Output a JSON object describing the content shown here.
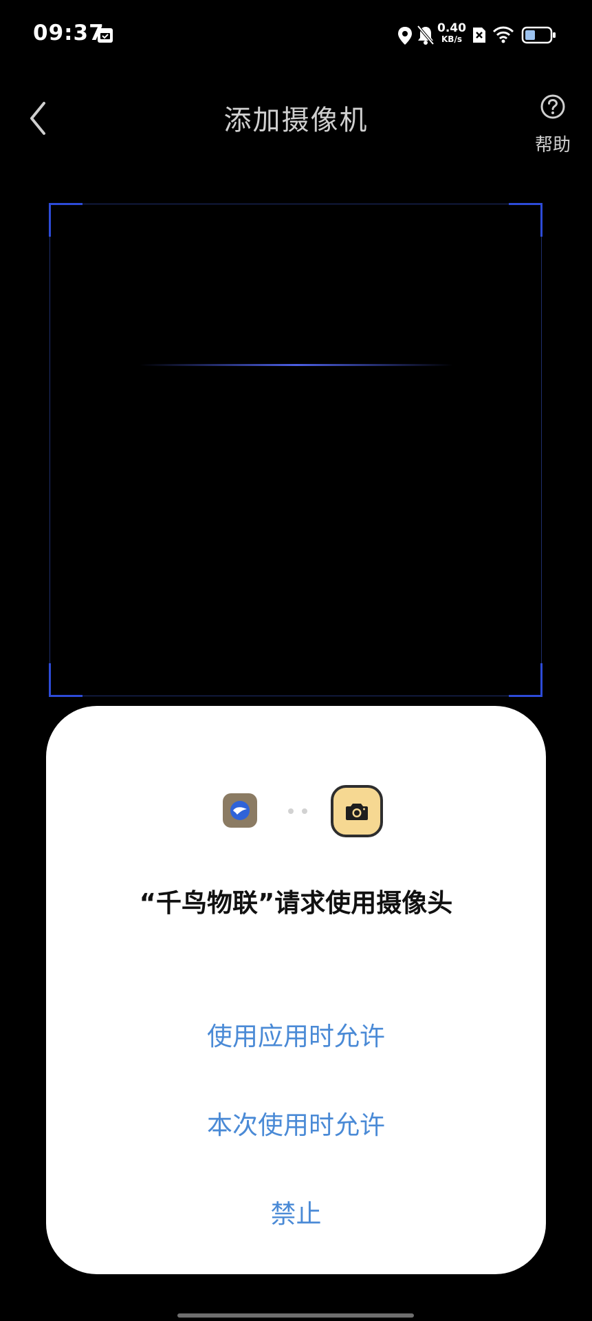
{
  "status_bar": {
    "time": "09:37",
    "net_speed_value": "0.40",
    "net_speed_unit": "KB/s",
    "icons": [
      "calendar-icon",
      "location-icon",
      "bell-muted-icon",
      "sim-blocked-icon",
      "wifi-icon",
      "battery-icon"
    ]
  },
  "header": {
    "title": "添加摄像机",
    "help_label": "帮助",
    "icons": [
      "back-chevron-icon",
      "help-circle-icon"
    ]
  },
  "scanner": {
    "accent_color": "#2d4bd8"
  },
  "permission_dialog": {
    "prompt": "“千鸟物联”请求使用摄像头",
    "options": {
      "allow_while_using": "使用应用时允许",
      "allow_this_time": "本次使用时允许",
      "deny": "禁止"
    },
    "option_color": "#4a8ad6",
    "icons": [
      "app-logo-icon",
      "camera-permission-icon"
    ]
  }
}
